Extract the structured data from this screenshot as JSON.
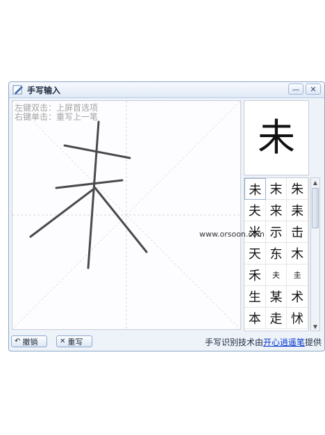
{
  "window": {
    "title": "手写输入",
    "minimize_glyph": "—",
    "close_glyph": "✕"
  },
  "canvas": {
    "hint_line1": "左键双击：上屏首选项",
    "hint_line2": "右键单击：重写上一笔"
  },
  "preview": {
    "char": "未"
  },
  "candidates": [
    "未",
    "末",
    "朱",
    "夫",
    "来",
    "耒",
    "米",
    "示",
    "击",
    "天",
    "东",
    "木",
    "禾",
    "夫",
    "圭",
    "生",
    "某",
    "术",
    "本",
    "走",
    "怵"
  ],
  "watermark": "www.orsoon.com",
  "buttons": {
    "undo_label": "撤销",
    "clear_label": "重写"
  },
  "credit": {
    "prefix": "手写识别技术由",
    "link": "开心逍遥笔",
    "suffix": "提供"
  },
  "colors": {
    "accent": "#0033cc",
    "frame": "#8aa6c8",
    "ink": "#4a4a4a"
  }
}
